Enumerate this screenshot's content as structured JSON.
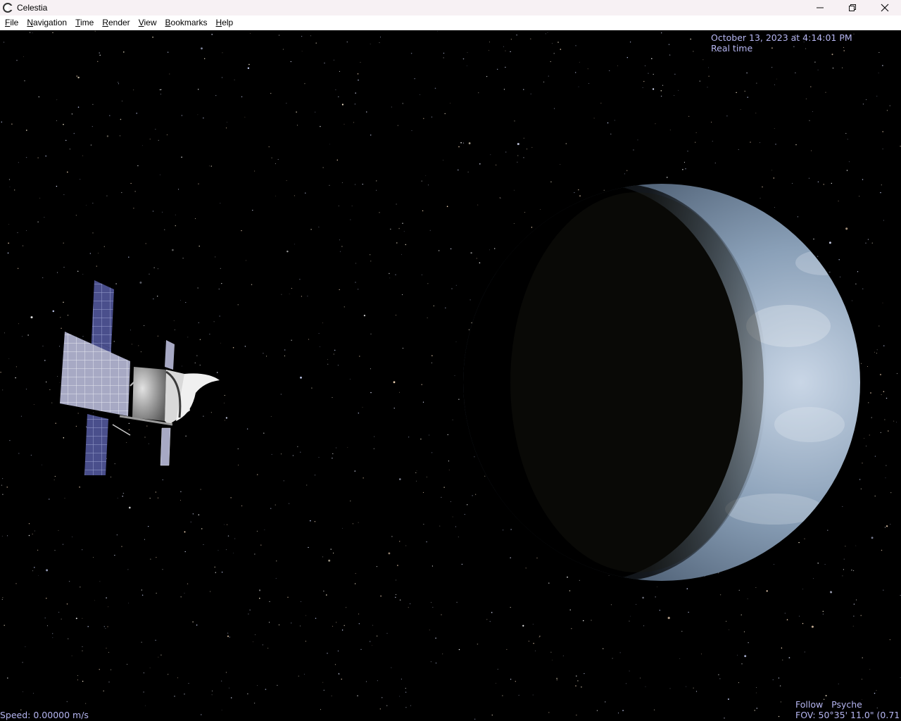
{
  "window": {
    "title": "Celestia"
  },
  "menu": [
    {
      "id": "file",
      "first": "F",
      "rest": "ile"
    },
    {
      "id": "navigation",
      "first": "N",
      "rest": "avigation"
    },
    {
      "id": "time",
      "first": "T",
      "rest": "ime"
    },
    {
      "id": "render",
      "first": "R",
      "rest": "ender"
    },
    {
      "id": "view",
      "first": "V",
      "rest": "iew"
    },
    {
      "id": "bookmarks",
      "first": "B",
      "rest": "ookmarks"
    },
    {
      "id": "help",
      "first": "H",
      "rest": "elp"
    }
  ],
  "hud": {
    "date": "October 13, 2023 at 4:14:01 PM",
    "time_mode": "Real time",
    "speed": "Speed: 0.00000 m/s",
    "follow": "Follow   Psyche",
    "fov": "FOV: 50°35' 11.0\" (0.71"
  },
  "colors": {
    "hud_text": "#b6b6f2",
    "titlebar_bg": "#f7f1f4",
    "space_bg": "#000000"
  },
  "icons": {
    "app": "celestia-logo-icon",
    "minimize": "minimize-icon",
    "maximize": "restore-icon",
    "close": "close-icon"
  }
}
